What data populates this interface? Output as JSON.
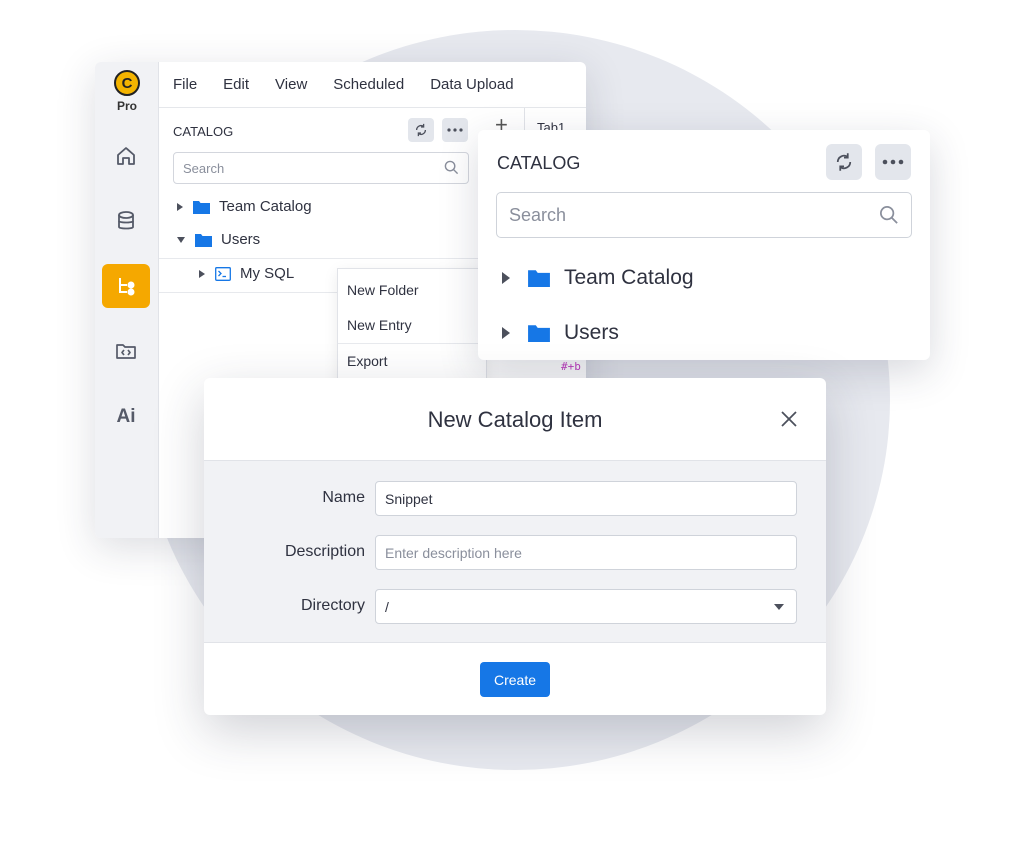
{
  "app": {
    "logo_letter": "C",
    "tier_label": "Pro",
    "rail": [
      {
        "icon": "home-icon"
      },
      {
        "icon": "database-icon"
      },
      {
        "icon": "catalog-tree-icon",
        "active": true
      },
      {
        "icon": "code-folder-icon"
      },
      {
        "label": "Ai"
      }
    ],
    "accent_color": "#f5a800"
  },
  "menubar": {
    "items": [
      "File",
      "Edit",
      "View",
      "Scheduled",
      "Data Upload"
    ]
  },
  "catalog_panel": {
    "title": "CATALOG",
    "search_placeholder": "Search",
    "tree": [
      {
        "label": "Team Catalog",
        "expanded": false
      },
      {
        "label": "Users",
        "expanded": true
      },
      {
        "label": "My SQL",
        "child": true
      }
    ]
  },
  "context_menu": {
    "items": [
      "New Folder",
      "New Entry",
      "Export"
    ]
  },
  "editor": {
    "tab_label": "Tab1",
    "code_fragment": "#+b"
  },
  "catalog_card": {
    "title": "CATALOG",
    "search_placeholder": "Search",
    "items": [
      "Team Catalog",
      "Users"
    ]
  },
  "modal": {
    "title": "New Catalog Item",
    "fields": {
      "name_label": "Name",
      "name_value": "Snippet",
      "description_label": "Description",
      "description_placeholder": "Enter description here",
      "directory_label": "Directory",
      "directory_value": "/"
    },
    "create_label": "Create",
    "primary_color": "#1677e6"
  }
}
